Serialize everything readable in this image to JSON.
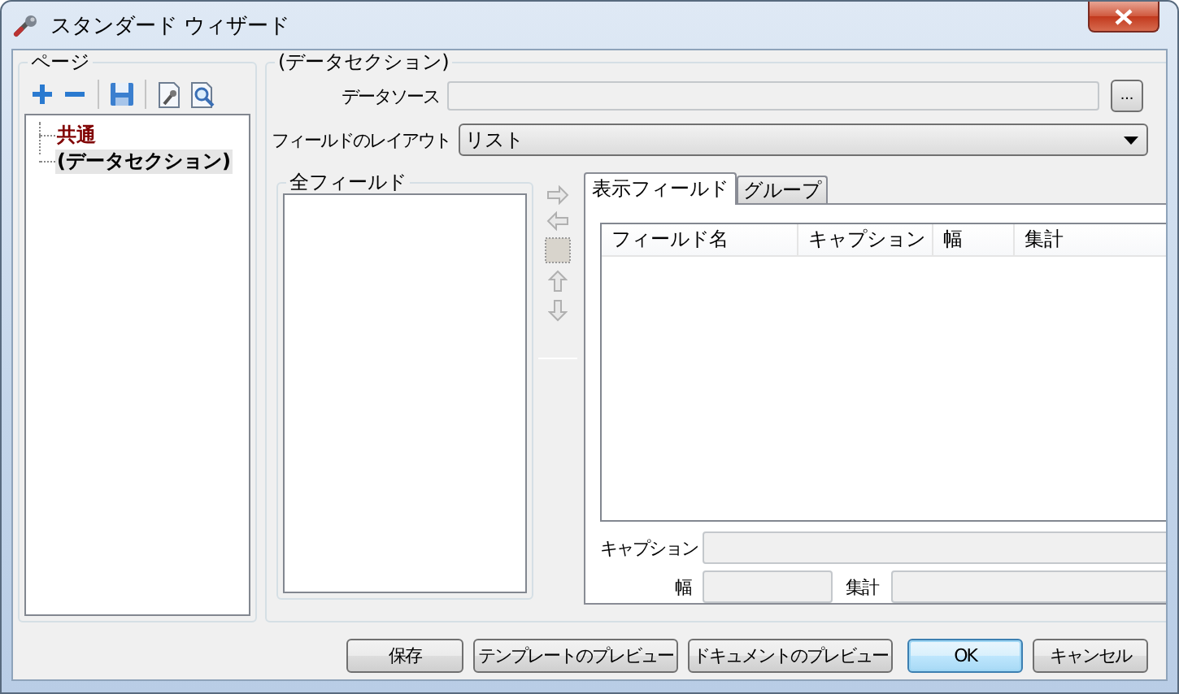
{
  "window": {
    "title": "スタンダード ウィザード"
  },
  "page_panel": {
    "title": "ページ",
    "tree": [
      {
        "label": "共通",
        "selected": false,
        "color": "#800000"
      },
      {
        "label": "(データセクション)",
        "selected": true,
        "color": "#000000"
      }
    ]
  },
  "section_panel": {
    "title": "(データセクション)",
    "data_source": {
      "label": "データソース",
      "browse_button": "..."
    },
    "layout": {
      "label": "フィールドのレイアウト",
      "value": "リスト"
    },
    "all_fields": {
      "title": "全フィールド"
    },
    "tabs": [
      {
        "label": "表示フィールド",
        "selected": true
      },
      {
        "label": "グループ",
        "selected": false
      }
    ],
    "table": {
      "columns": [
        "フィールド名",
        "キャプション",
        "幅",
        "集計"
      ]
    },
    "detail": {
      "caption_label": "キャプション",
      "width_label": "幅",
      "aggregate_label": "集計"
    }
  },
  "buttons": [
    {
      "label": "保存",
      "default": false
    },
    {
      "label": "テンプレートのプレビュー",
      "default": false
    },
    {
      "label": "ドキュメントのプレビュー",
      "default": false
    },
    {
      "label": "OK",
      "default": true
    },
    {
      "label": "キャンセル",
      "default": false
    }
  ]
}
